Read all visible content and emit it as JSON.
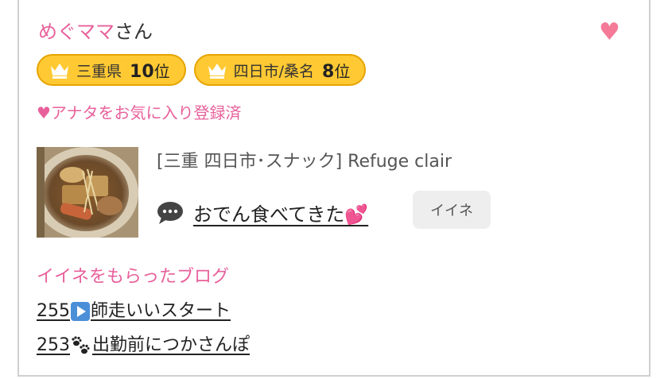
{
  "user": {
    "name": "めぐママ",
    "suffix": "さん"
  },
  "badges": [
    {
      "area": "三重県",
      "rank": "10",
      "unit": "位"
    },
    {
      "area": "四日市/桑名",
      "rank": "8",
      "unit": "位"
    }
  ],
  "favorite_status": "♥アナタをお気に入り登録済",
  "post": {
    "shop": "[三重 四日市･スナック]  Refuge clair",
    "title": "おでん食べてきた💕",
    "iine_label": "イイネ"
  },
  "blogs": {
    "heading": "イイネをもらったブログ",
    "items": [
      {
        "count": "255",
        "icon": "play-button-icon",
        "text": "師走いいスタート"
      },
      {
        "count": "253",
        "icon": "paw-prints-icon",
        "text": "出勤前につかさんぽ"
      }
    ]
  },
  "colors": {
    "accent_pink": "#e8609b",
    "heart": "#f47a98",
    "badge_fill": "#ffc933",
    "badge_border": "#e6a400"
  }
}
